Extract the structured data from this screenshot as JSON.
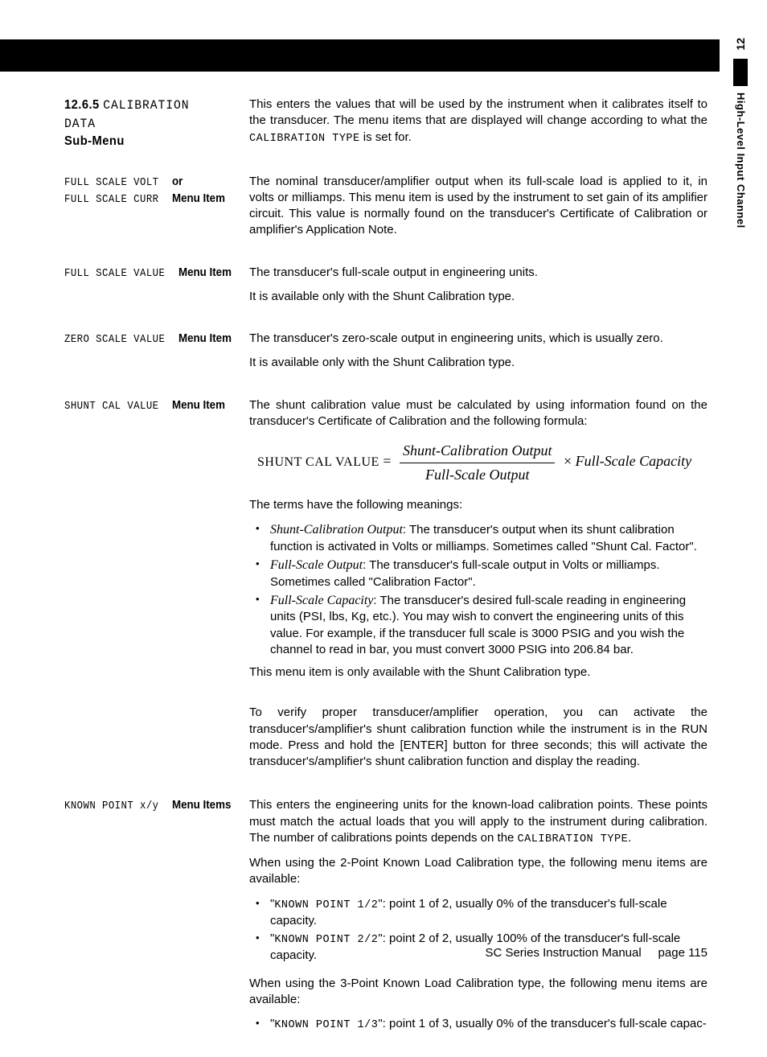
{
  "sidetab": {
    "number": "12",
    "label": "High-Level Input Channel"
  },
  "sections": [
    {
      "left_type": "heading",
      "left_parts": [
        "12.6.5 ",
        "CALIBRATION DATA",
        " Sub-Menu"
      ],
      "body": [
        {
          "type": "p_mixed",
          "parts": [
            {
              "t": "This enters the values that will be used by the instrument when it calibrates itself to the transducer.  The menu items that are displayed will change according to what the "
            },
            {
              "t": "CALIBRATION TYPE",
              "cls": "mono"
            },
            {
              "t": " is set for."
            }
          ]
        }
      ]
    },
    {
      "left_type": "menu",
      "left_lines": [
        [
          {
            "t": "FULL SCALE VOLT",
            "cls": "menulabel"
          },
          {
            "t": " or",
            "cls": "menubold"
          }
        ],
        [
          {
            "t": "FULL SCALE CURR",
            "cls": "menulabel"
          },
          {
            "t": " Menu Item",
            "cls": "menubold"
          }
        ]
      ],
      "body": [
        {
          "type": "p",
          "text": "The nominal transducer/amplifier output when its full-scale load is applied to it, in volts or milliamps.  This menu item is used by the instrument to set gain of its amplifier circuit.  This value is normally found on the transducer's Certificate of Calibration or amplifier's Application Note."
        }
      ]
    },
    {
      "left_type": "menu",
      "left_lines": [
        [
          {
            "t": "FULL SCALE VALUE",
            "cls": "menulabel"
          },
          {
            "t": " Menu Item",
            "cls": "menubold"
          }
        ]
      ],
      "body": [
        {
          "type": "p",
          "text": "The transducer's full-scale output in engineering units."
        },
        {
          "type": "p",
          "text": "It is available only with the Shunt Calibration type."
        }
      ]
    },
    {
      "left_type": "menu",
      "left_lines": [
        [
          {
            "t": "ZERO SCALE VALUE",
            "cls": "menulabel"
          },
          {
            "t": " Menu Item",
            "cls": "menubold"
          }
        ]
      ],
      "body": [
        {
          "type": "p",
          "text": "The transducer's zero-scale output in engineering units, which is usually zero."
        },
        {
          "type": "p",
          "text": "It is available only with the Shunt Calibration type."
        }
      ]
    },
    {
      "left_type": "menu",
      "left_lines": [
        [
          {
            "t": "SHUNT CAL VALUE",
            "cls": "menulabel"
          },
          {
            "t": " Menu Item",
            "cls": "menubold"
          }
        ]
      ],
      "body": [
        {
          "type": "p",
          "text": "The shunt calibration value must be calculated by using information found on the transducer's Certificate of Calibration and the following formula:"
        },
        {
          "type": "formula",
          "lhs": "SHUNT CAL VALUE",
          "top": "Shunt-Calibration Output",
          "bot": "Full-Scale Output",
          "tail": "Full-Scale Capacity"
        },
        {
          "type": "p",
          "text": "The terms have the following meanings:"
        },
        {
          "type": "ul",
          "items": [
            [
              {
                "t": "Shunt-Calibration Output",
                "cls": "ital"
              },
              {
                "t": ": The transducer's output when its shunt calibration function is activated in Volts or milliamps. Sometimes called \"Shunt Cal. Factor\"."
              }
            ],
            [
              {
                "t": "Full-Scale Output",
                "cls": "ital"
              },
              {
                "t": ": The transducer's full-scale output in Volts or milliamps. Sometimes called \"Calibration Factor\"."
              }
            ],
            [
              {
                "t": "Full-Scale Capacity",
                "cls": "ital"
              },
              {
                "t": ": The transducer's desired full-scale reading in engineering units (PSI, lbs, Kg, etc.).  You may wish to convert the engineering units of this value.  For example, if the transducer full scale is 3000 PSIG and you wish the channel to read in bar, you must convert 3000 PSIG into 206.84 bar."
              }
            ]
          ]
        },
        {
          "type": "p",
          "text": "This menu item is only available with the Shunt Calibration type."
        },
        {
          "type": "spacer"
        },
        {
          "type": "p",
          "text": "To verify proper transducer/amplifier operation, you can activate the transducer's/amplifier's shunt calibration function while the instrument is in the RUN mode. Press and hold the [ENTER] button for three seconds; this will activate the transducer's/amplifier's  shunt calibration function and display the reading."
        }
      ]
    },
    {
      "left_type": "menu",
      "left_lines": [
        [
          {
            "t": "KNOWN POINT x/y",
            "cls": "menulabel"
          },
          {
            "t": " Menu Items",
            "cls": "menubold"
          }
        ]
      ],
      "body": [
        {
          "type": "p_mixed",
          "parts": [
            {
              "t": "This enters the engineering units for the known-load calibration points.  These points must match the actual loads that you will apply to the instrument during calibration.  The number of calibrations points depends on the "
            },
            {
              "t": "CALIBRATION TYPE",
              "cls": "mono"
            },
            {
              "t": "."
            }
          ]
        },
        {
          "type": "p",
          "text": "When using the 2-Point Known Load Calibration type, the following menu items are available:"
        },
        {
          "type": "ul",
          "items": [
            [
              {
                "t": "\""
              },
              {
                "t": "KNOWN POINT 1/2",
                "cls": "mono"
              },
              {
                "t": "\": point 1 of 2, usually 0% of the transducer's full-scale capacity."
              }
            ],
            [
              {
                "t": "\""
              },
              {
                "t": "KNOWN POINT 2/2",
                "cls": "mono"
              },
              {
                "t": "\":  point 2 of 2, usually 100% of the transducer's full-scale capacity."
              }
            ]
          ]
        },
        {
          "type": "spacer-sm"
        },
        {
          "type": "p",
          "text": "When using the 3-Point Known Load Calibration type, the following menu items are available:"
        },
        {
          "type": "ul",
          "items": [
            [
              {
                "t": "\""
              },
              {
                "t": "KNOWN POINT 1/3",
                "cls": "mono"
              },
              {
                "t": "\": point 1 of 3, usually 0% of the transducer's full-scale capac-"
              }
            ]
          ]
        }
      ]
    }
  ],
  "footer": {
    "manual": "SC Series Instruction Manual",
    "page_label": "page 115"
  }
}
